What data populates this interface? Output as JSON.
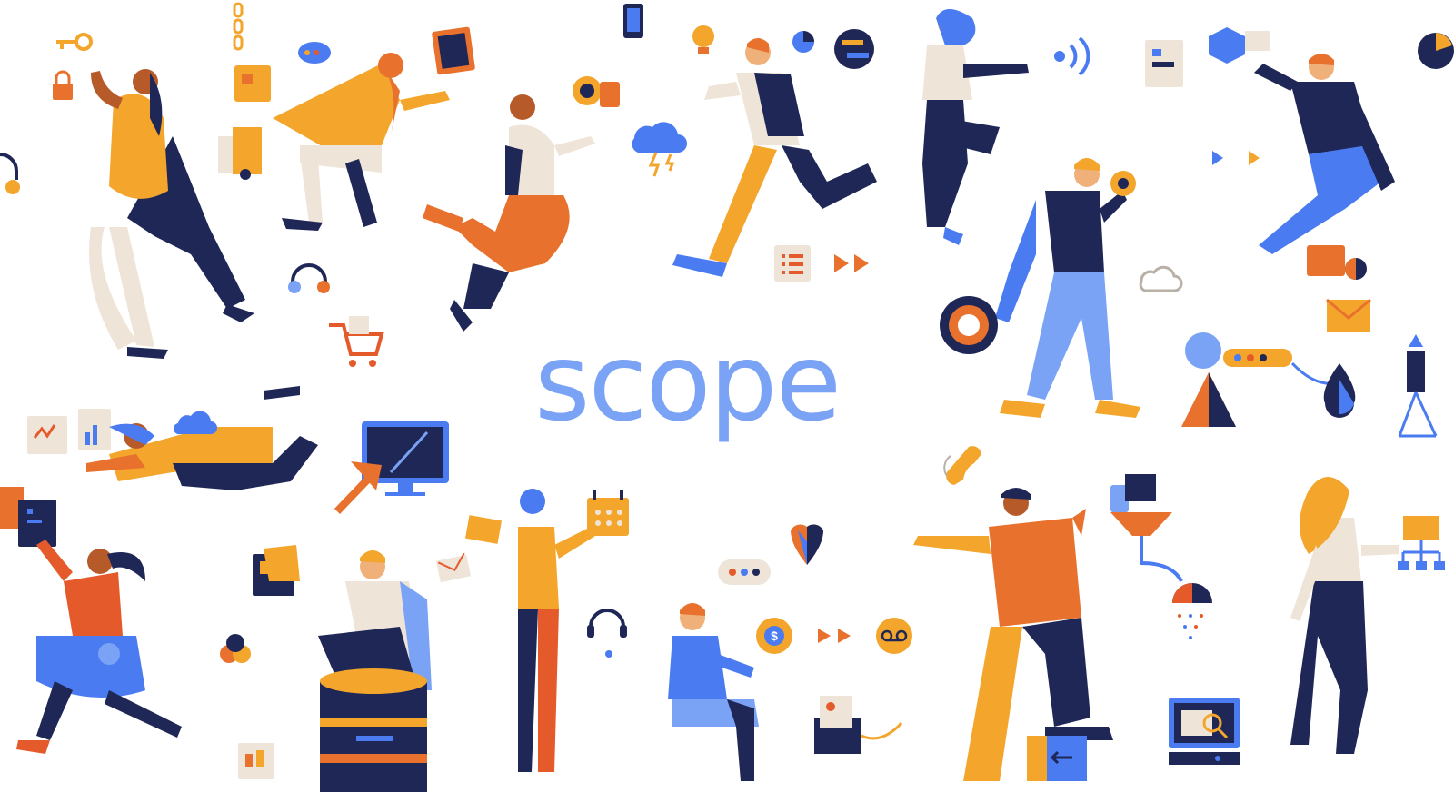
{
  "brand": {
    "name": "scope",
    "color": "#7aa2f5"
  },
  "palette": {
    "navy": "#1f2756",
    "blue": "#4a7bf0",
    "light_blue": "#7aa2f5",
    "yellow": "#f3a52c",
    "orange": "#e8722d",
    "red_orange": "#e55a2b",
    "cream": "#efe4d8",
    "skin_dark": "#b75a2a",
    "skin_light": "#f0b07a"
  },
  "illustration": {
    "figures": [
      "woman-with-key-and-lock",
      "man-on-cart-with-tablet",
      "man-floating-with-gear",
      "man-running-with-lightbulb",
      "woman-pointing-at-signal",
      "man-with-pie-chart",
      "woman-flying-with-charts",
      "man-walking-with-gear",
      "woman-with-monitor-cursor",
      "woman-running-with-documents",
      "man-sitting-on-database",
      "woman-with-headset-and-calendar",
      "woman-sitting-with-coin-gear",
      "man-on-phone-thumbs-up",
      "woman-with-hierarchy-chart"
    ],
    "icons": [
      "key-icon",
      "lock-icon",
      "chain-icon",
      "chat-bubble-icon",
      "phone-icon",
      "lightbulb-icon",
      "pie-chart-icon",
      "swap-icon",
      "signal-icon",
      "list-card-icon",
      "cloud-icon",
      "headset-icon",
      "cart-icon",
      "play-arrows-icon",
      "envelope-icon",
      "heart-icon",
      "voicemail-icon",
      "dollar-gear-icon",
      "monitor-icon",
      "cursor-icon",
      "droplet-icon",
      "magnifier-icon",
      "shower-icon",
      "database-icon"
    ]
  }
}
